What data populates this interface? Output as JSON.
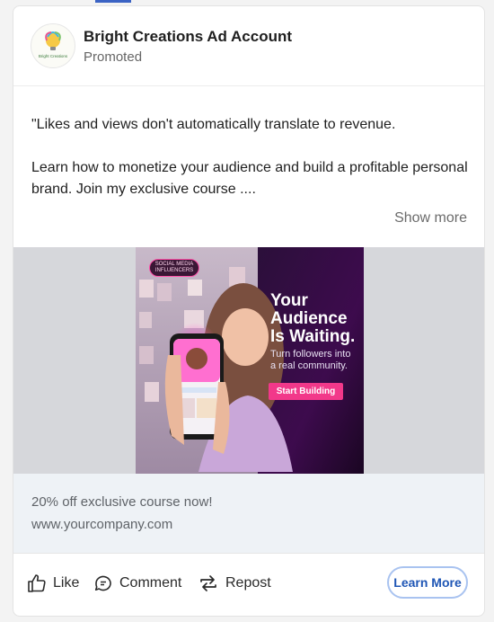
{
  "post": {
    "account_name": "Bright Creations Ad Account",
    "subtitle": "Promoted",
    "avatar_text": "Bright Creations",
    "body_lines": [
      "\"Likes and views don't automatically translate to revenue.",
      "Learn how to monetize your audience and build a profitable personal brand. Join my exclusive course ...."
    ],
    "show_more": "Show more"
  },
  "ad_image": {
    "badge": "SOCIAL MEDIA INFLUENCERS",
    "headline_lines": [
      "Your",
      "Audience",
      "Is Waiting."
    ],
    "subtext": "Turn followers into a real community.",
    "cta": "Start Building"
  },
  "caption": {
    "title": "20% off exclusive course now!",
    "url": "www.yourcompany.com"
  },
  "actions": {
    "like": "Like",
    "comment": "Comment",
    "repost": "Repost",
    "learn_more": "Learn More"
  },
  "colors": {
    "accent": "#3b63c4",
    "cta_pink": "#f2388a",
    "learn_more_border": "#a9c3f0",
    "learn_more_text": "#1f56b5"
  }
}
